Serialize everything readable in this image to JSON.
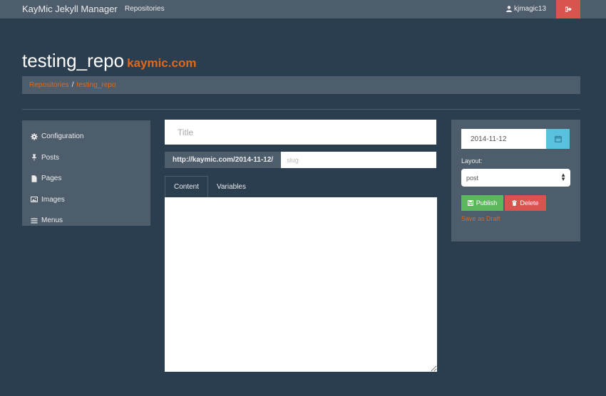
{
  "navbar": {
    "brand": "KayMic Jekyll Manager",
    "repositories_link": "Repositories",
    "username": "kjmagic13",
    "user_icon": "user-icon",
    "logout_icon": "sign-out-icon"
  },
  "header": {
    "repo_name": "testing_repo",
    "site": "kaymic.com"
  },
  "breadcrumb": {
    "items": [
      "Repositories",
      "testing_repo"
    ],
    "separator": "/"
  },
  "sidebar": {
    "items": [
      {
        "label": "Configuration",
        "icon": "cog-icon"
      },
      {
        "label": "Posts",
        "icon": "pushpin-icon"
      },
      {
        "label": "Pages",
        "icon": "file-icon"
      },
      {
        "label": "Images",
        "icon": "picture-icon"
      },
      {
        "label": "Menus",
        "icon": "list-icon"
      }
    ]
  },
  "editor": {
    "title_placeholder": "Title",
    "url_prefix": "http://kaymic.com/2014-11-12/",
    "slug_placeholder": "slug",
    "tabs": [
      "Content",
      "Variables"
    ],
    "active_tab": "Content",
    "content": ""
  },
  "panel": {
    "date": "2014-11-12",
    "layout_label": "Layout:",
    "layout_value": "post",
    "publish_label": "Publish",
    "delete_label": "Delete",
    "draft_label": "Save as Draft"
  },
  "colors": {
    "background": "#2b3e50",
    "panel": "#4e5d6c",
    "accent": "#df691a",
    "success": "#5cb85c",
    "danger": "#d9534f",
    "info": "#5bc0de"
  }
}
